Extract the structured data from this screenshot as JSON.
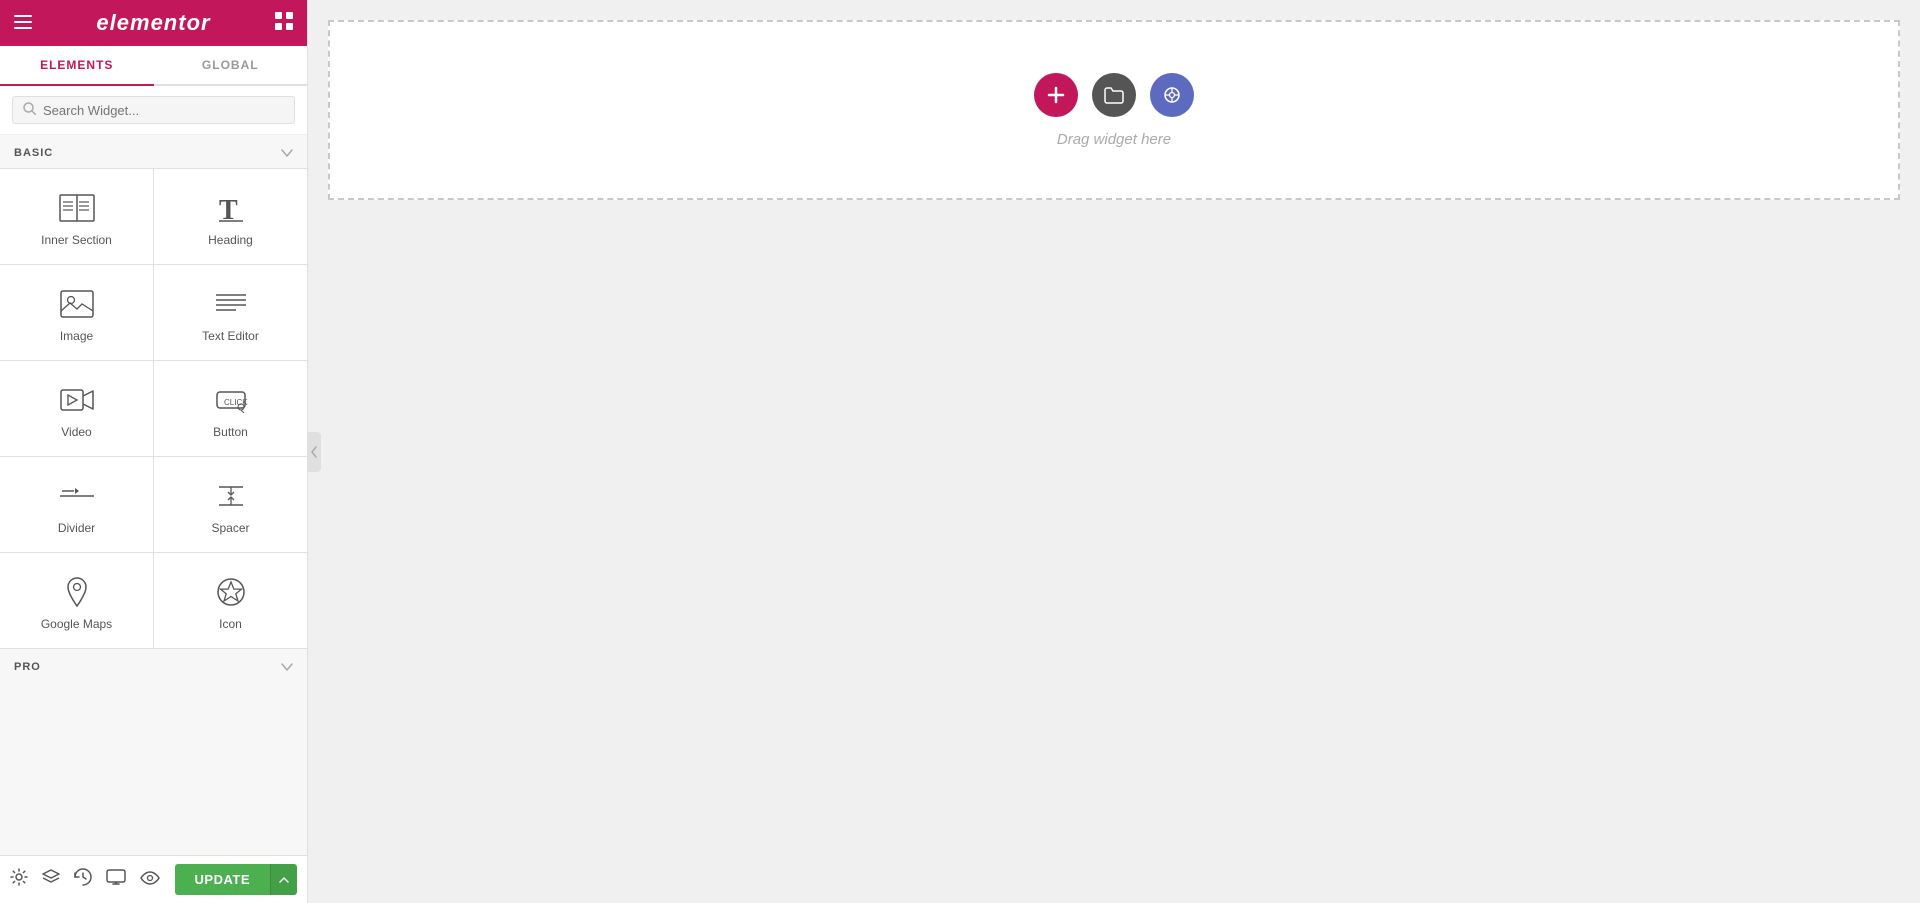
{
  "header": {
    "logo": "elementor",
    "hamburger_icon": "☰",
    "grid_icon": "⊞"
  },
  "tabs": [
    {
      "id": "elements",
      "label": "ELEMENTS",
      "active": true
    },
    {
      "id": "global",
      "label": "GLOBAL",
      "active": false
    }
  ],
  "search": {
    "placeholder": "Search Widget..."
  },
  "sections": [
    {
      "id": "basic",
      "title": "BASIC",
      "expanded": true,
      "widgets": [
        {
          "id": "inner-section",
          "label": "Inner Section",
          "icon": "inner-section-icon"
        },
        {
          "id": "heading",
          "label": "Heading",
          "icon": "heading-icon"
        },
        {
          "id": "image",
          "label": "Image",
          "icon": "image-icon"
        },
        {
          "id": "text-editor",
          "label": "Text Editor",
          "icon": "text-editor-icon"
        },
        {
          "id": "video",
          "label": "Video",
          "icon": "video-icon"
        },
        {
          "id": "button",
          "label": "Button",
          "icon": "button-icon"
        },
        {
          "id": "divider",
          "label": "Divider",
          "icon": "divider-icon"
        },
        {
          "id": "spacer",
          "label": "Spacer",
          "icon": "spacer-icon"
        },
        {
          "id": "google-maps",
          "label": "Google Maps",
          "icon": "google-maps-icon"
        },
        {
          "id": "icon",
          "label": "Icon",
          "icon": "icon-widget-icon"
        }
      ]
    },
    {
      "id": "pro",
      "title": "PRO",
      "expanded": false,
      "widgets": []
    }
  ],
  "canvas": {
    "drag_text": "Drag widget here",
    "add_label": "+",
    "folder_label": "⬛",
    "template_label": "…"
  },
  "footer": {
    "settings_icon": "⚙",
    "layers_icon": "layers",
    "history_icon": "↺",
    "responsive_icon": "🖥",
    "eye_icon": "👁",
    "update_btn": "UPDATE",
    "update_dropdown_arrow": "▲"
  }
}
